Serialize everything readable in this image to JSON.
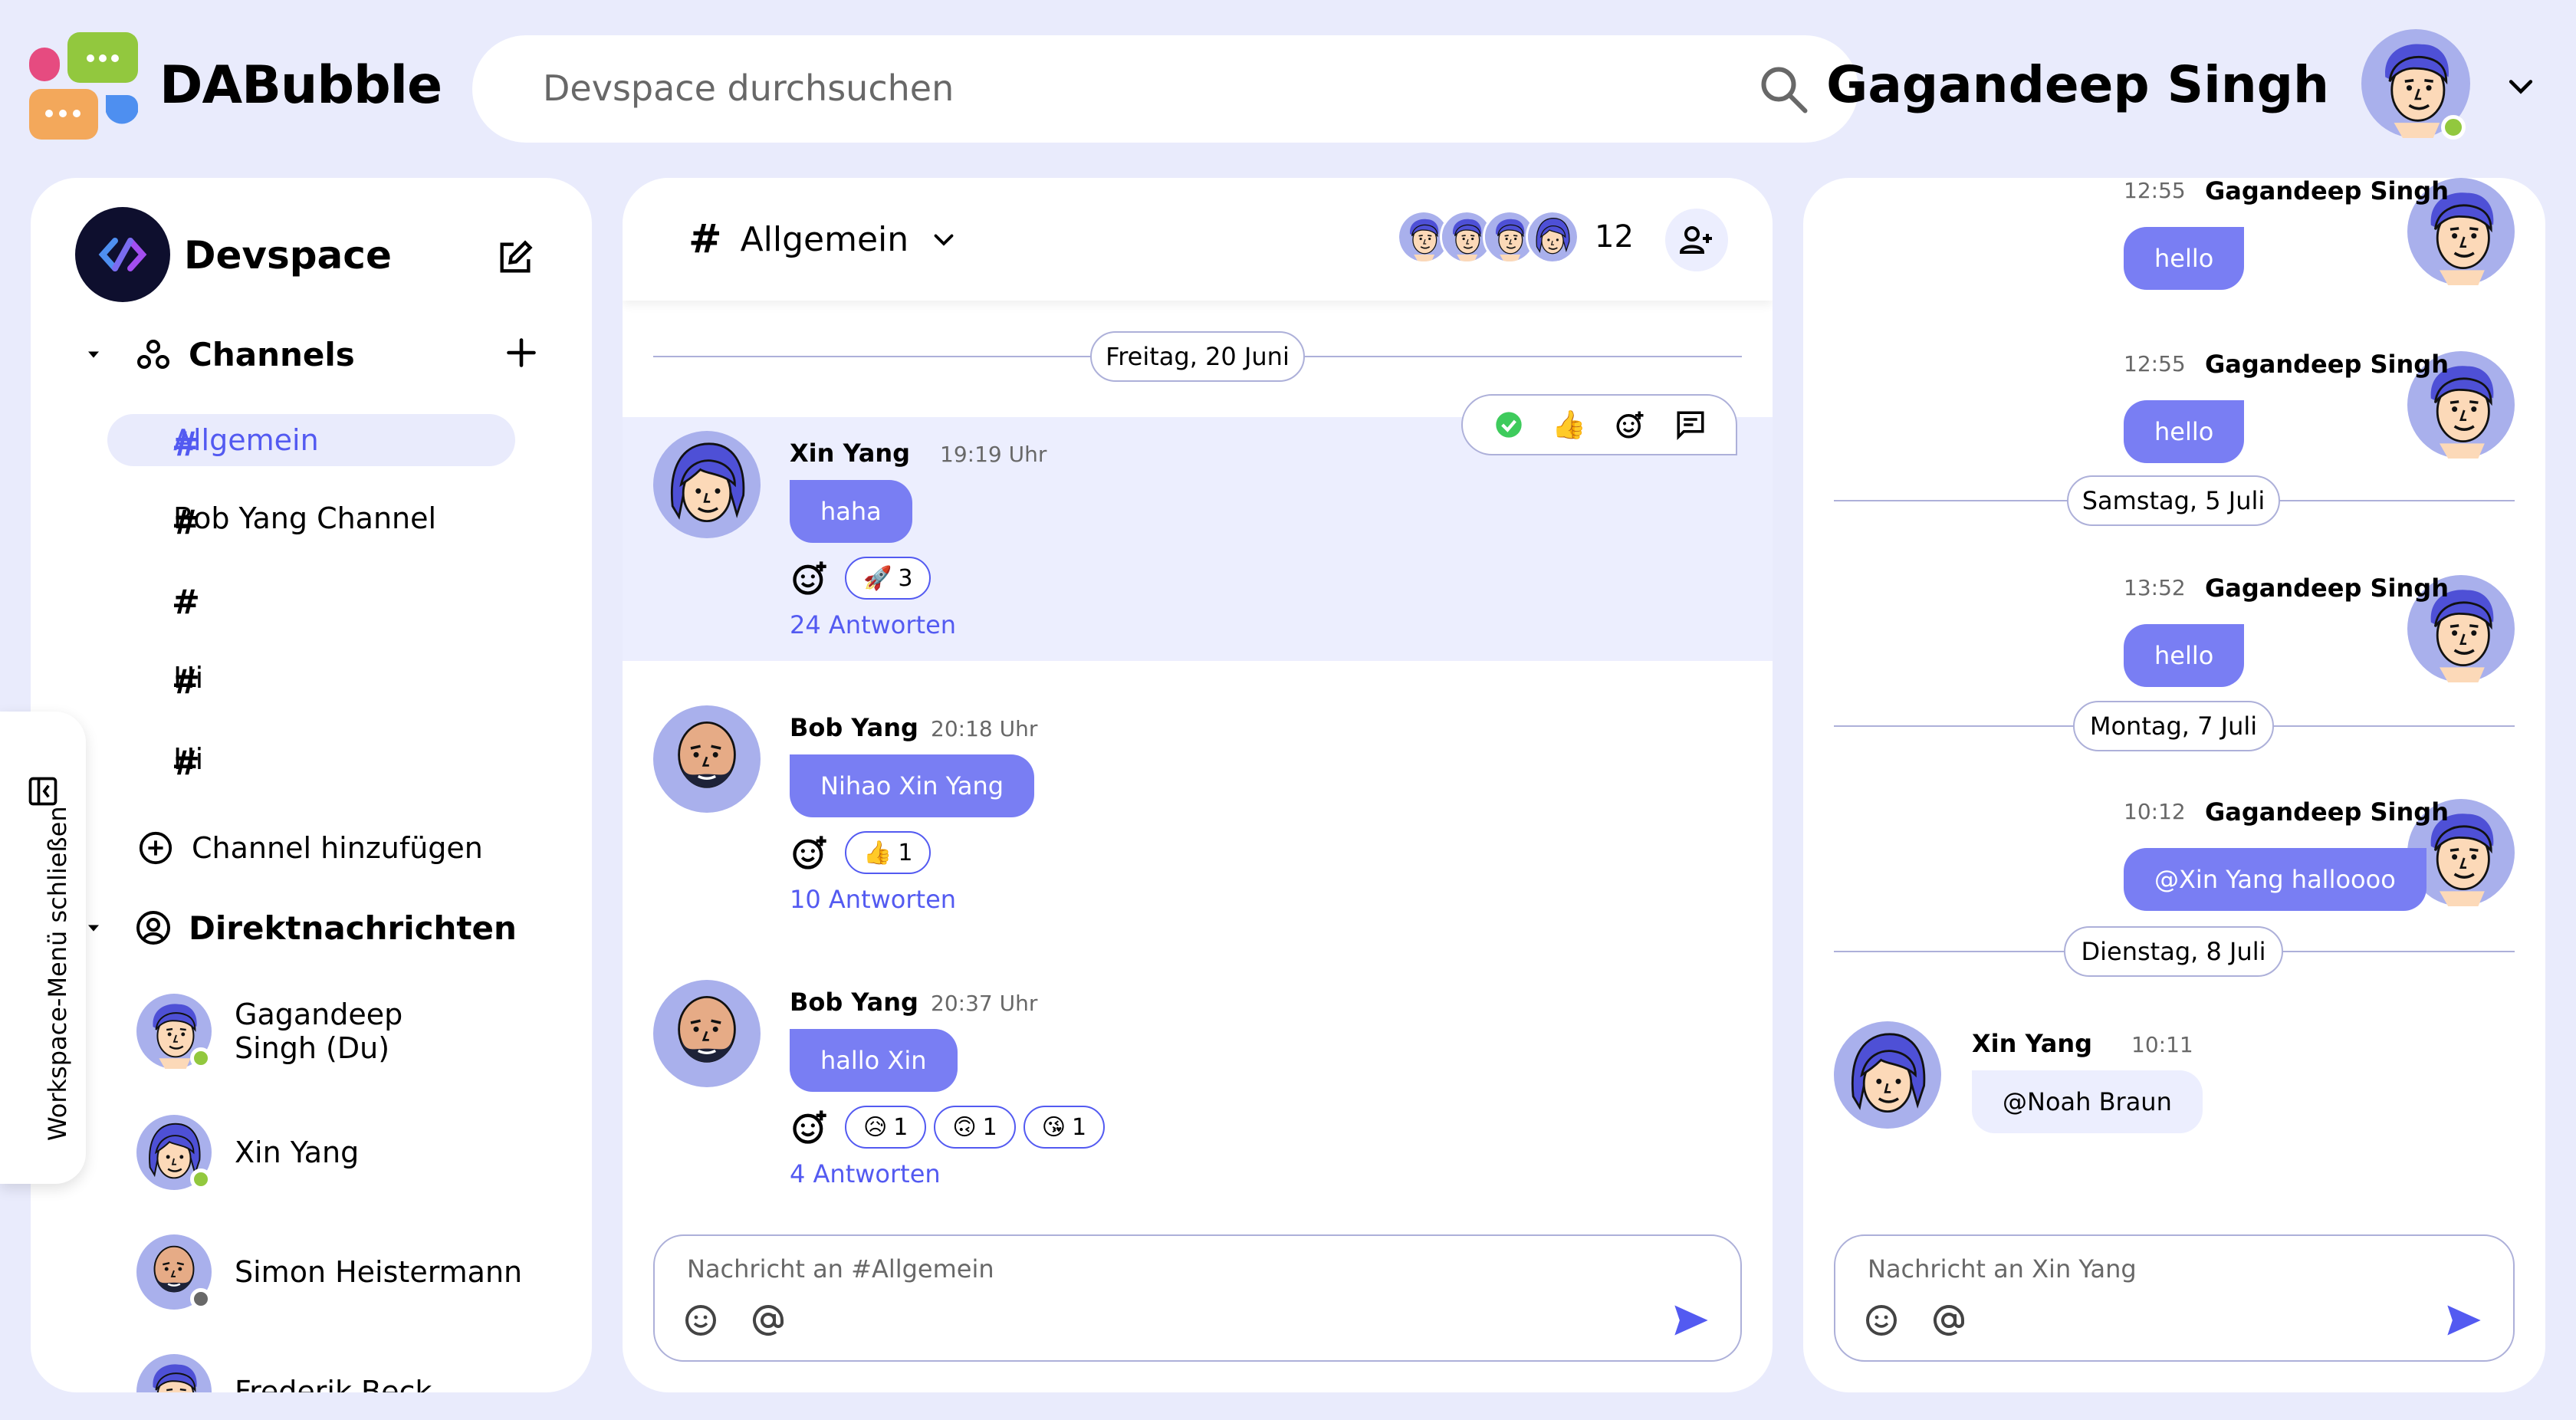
{
  "app": {
    "name": "DABubble",
    "search_placeholder": "Devspace durchsuchen",
    "current_user": "Gagandeep Singh"
  },
  "colors": {
    "background": "#e9ebfc",
    "accent": "#535af1",
    "bubble": "#797ef3",
    "online": "#92c83e"
  },
  "sidebar": {
    "workspace_name": "Devspace",
    "channels_label": "Channels",
    "channels": [
      {
        "label": "Allgemein",
        "active": true
      },
      {
        "label": "Bob Yang Channel",
        "active": false
      },
      {
        "label": "",
        "active": false
      },
      {
        "label": "Hi",
        "active": false
      },
      {
        "label": "Hi",
        "active": false
      }
    ],
    "add_channel_label": "Channel hinzufügen",
    "dm_label": "Direktnachrichten",
    "dms": [
      {
        "name": "Gagandeep Singh (Du)",
        "status": "online"
      },
      {
        "name": "Xin Yang",
        "status": "online"
      },
      {
        "name": "Simon Heistermann",
        "status": "offline"
      },
      {
        "name": "Frederik Beck",
        "status": "online"
      }
    ],
    "collapse_label": "Workspace-Menü schließen"
  },
  "channel": {
    "hash": "#",
    "name": "Allgemein",
    "member_count": "12",
    "date_divider": "Freitag, 20 Juni",
    "toolbar_icons": [
      "check-icon",
      "thumbs-up-icon",
      "add-reaction-icon",
      "comment-icon"
    ],
    "messages": [
      {
        "author": "Xin Yang",
        "time": "19:19 Uhr",
        "text": "haha",
        "reactions": [
          {
            "emoji": "🚀",
            "count": "3"
          }
        ],
        "replies": "24 Antworten"
      },
      {
        "author": "Bob Yang",
        "time": "20:18 Uhr",
        "text": "Nihao Xin Yang",
        "reactions": [
          {
            "emoji": "👍",
            "count": "1"
          }
        ],
        "replies": "10 Antworten"
      },
      {
        "author": "Bob Yang",
        "time": "20:37 Uhr",
        "text": "hallo Xin",
        "reactions": [
          {
            "emoji": "😥",
            "count": "1"
          },
          {
            "emoji": "🙃",
            "count": "1"
          },
          {
            "emoji": "😘",
            "count": "1"
          }
        ],
        "replies": "4 Antworten"
      }
    ],
    "composer_placeholder": "Nachricht an #Allgemein"
  },
  "dm": {
    "messages": [
      {
        "time": "12:55",
        "author": "Gagandeep Singh",
        "text": "hello"
      },
      {
        "time": "12:55",
        "author": "Gagandeep Singh",
        "text": "hello"
      },
      {
        "time": "13:52",
        "author": "Gagandeep Singh",
        "text": "hello"
      },
      {
        "time": "10:12",
        "author": "Gagandeep Singh",
        "text": "@Xin Yang halloooo"
      }
    ],
    "dividers": [
      "Samstag, 5 Juli",
      "Montag, 7 Juli",
      "Dienstag, 8 Juli"
    ],
    "incoming": {
      "author": "Xin Yang",
      "time": "10:11",
      "text": "@Noah Braun"
    },
    "composer_placeholder": "Nachricht an Xin Yang"
  }
}
